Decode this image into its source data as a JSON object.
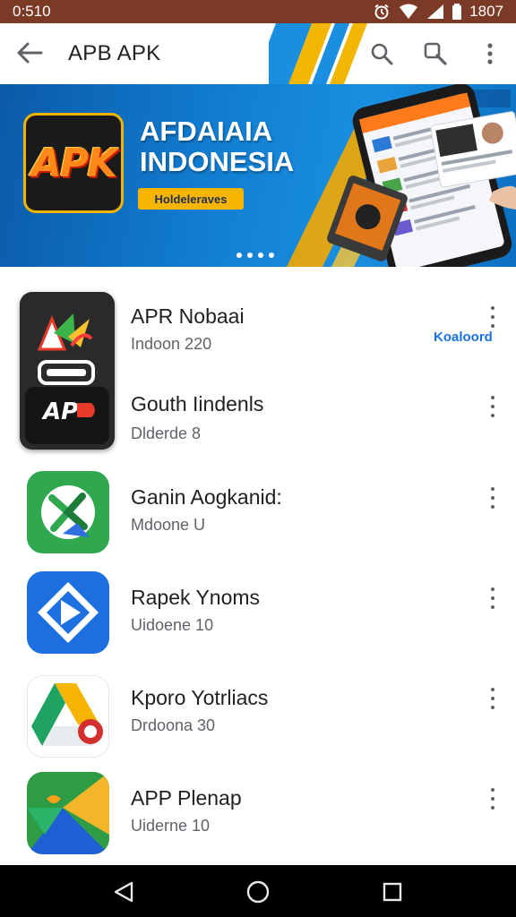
{
  "status_bar": {
    "time": "0:510",
    "battery": "1807"
  },
  "app_bar": {
    "title": "APB APK"
  },
  "banner": {
    "logo_text": "APK",
    "headline_line1": "AFDAIAIA",
    "headline_line2": "INDONESIA",
    "tagline": "Holdeleraves"
  },
  "install_link": "Koaloord",
  "apps": [
    {
      "name": "APR Nobaai",
      "subtitle": "Indoon 220"
    },
    {
      "name": "Gouth Iindenls",
      "subtitle": "Dlderde 8"
    },
    {
      "name": "Ganin Aogkanid:",
      "subtitle": "Mdoone U"
    },
    {
      "name": "Rapek Ynoms",
      "subtitle": "Uidoene 10"
    },
    {
      "name": "Kporo Yotrliacs",
      "subtitle": "Drdoona 30"
    },
    {
      "name": "APP Plenap",
      "subtitle": "Uiderne 10"
    }
  ],
  "colors": {
    "status_bar": "#7a3a26",
    "banner_blue": "#1280d4",
    "accent_yellow": "#f7b500",
    "link_blue": "#1a73e8"
  },
  "icons": {
    "back": "arrow-left-icon",
    "search": "search-icon",
    "search_alt": "search-alt-icon",
    "more": "more-vert-icon",
    "nav_back": "triangle-back-icon",
    "nav_home": "circle-home-icon",
    "nav_recents": "square-recents-icon"
  }
}
